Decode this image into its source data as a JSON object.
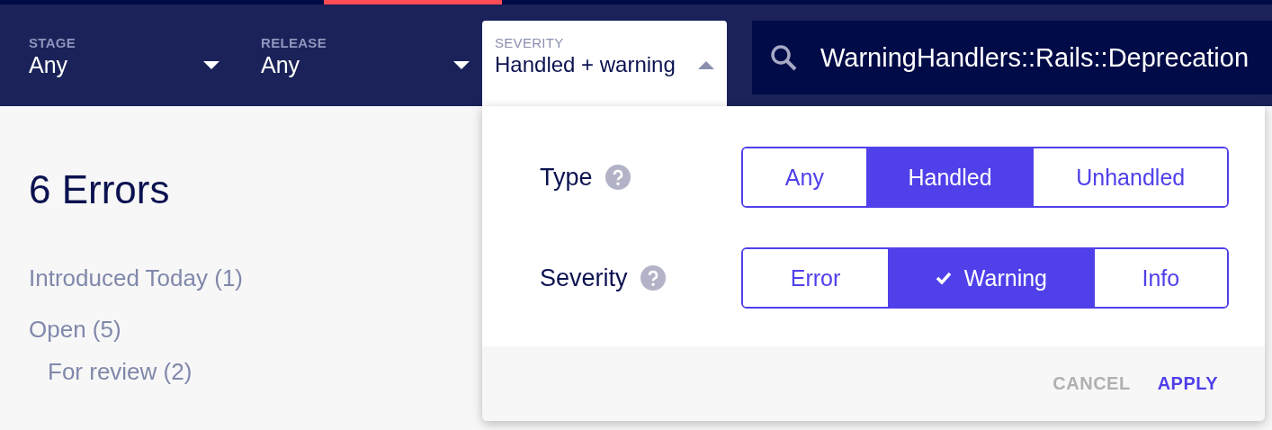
{
  "filters": [
    {
      "label": "STAGE",
      "value": "Any",
      "expanded": false
    },
    {
      "label": "RELEASE",
      "value": "Any",
      "expanded": false
    },
    {
      "label": "SEVERITY",
      "value": "Handled + warning",
      "expanded": true
    }
  ],
  "search": {
    "value": "WarningHandlers::Rails::Deprecation"
  },
  "title": "6 Errors",
  "sidebar": {
    "items": [
      {
        "label": "Introduced Today (1)"
      },
      {
        "label": "Open (5)",
        "children": [
          {
            "label": "For review (2)"
          }
        ]
      }
    ]
  },
  "dropdown": {
    "groups": [
      {
        "label": "Type",
        "options": [
          {
            "label": "Any",
            "selected": false,
            "checked": false
          },
          {
            "label": "Handled",
            "selected": true,
            "checked": false
          },
          {
            "label": "Unhandled",
            "selected": false,
            "checked": false
          }
        ]
      },
      {
        "label": "Severity",
        "options": [
          {
            "label": "Error",
            "selected": false,
            "checked": false
          },
          {
            "label": "Warning",
            "selected": true,
            "checked": true
          },
          {
            "label": "Info",
            "selected": false,
            "checked": false
          }
        ]
      }
    ],
    "buttons": [
      {
        "label": "CANCEL",
        "kind": "secondary"
      },
      {
        "label": "APPLY",
        "kind": "primary"
      }
    ]
  }
}
